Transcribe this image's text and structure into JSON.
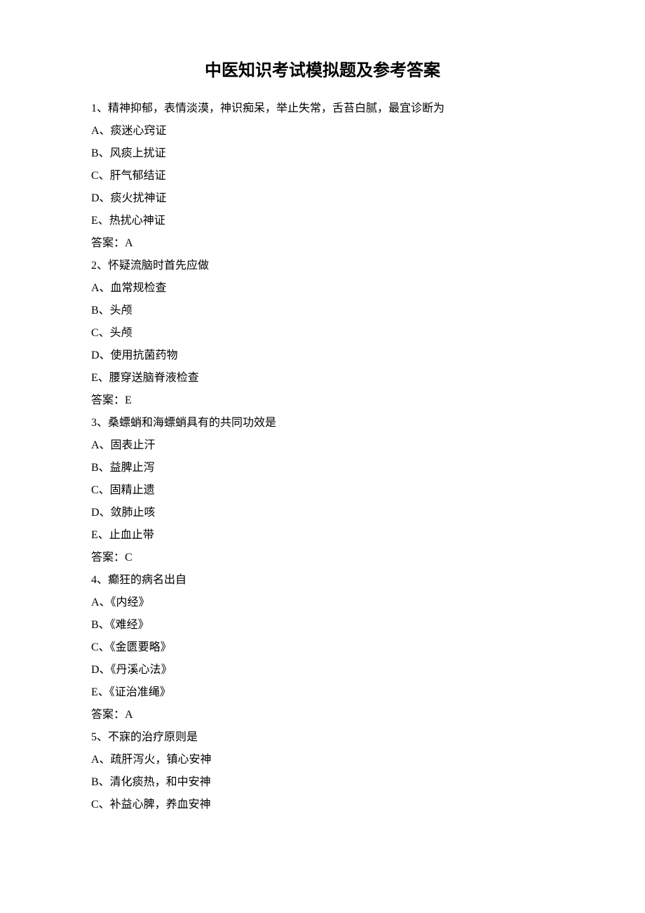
{
  "title": "中医知识考试模拟题及参考答案",
  "questions": [
    {
      "stem": "1、精神抑郁，表情淡漠，神识痴呆，举止失常，舌苔白腻，最宜诊断为",
      "options": [
        "A、痰迷心窍证",
        "B、风痰上扰证",
        "C、肝气郁结证",
        "D、痰火扰神证",
        "E、热扰心神证"
      ],
      "answer": "答案：A"
    },
    {
      "stem": "2、怀疑流脑时首先应做",
      "options": [
        "A、血常规检查",
        "B、头颅",
        "C、头颅",
        "D、使用抗菌药物",
        "E、腰穿送脑脊液检查"
      ],
      "answer": "答案：E"
    },
    {
      "stem": "3、桑螵蛸和海螵蛸具有的共同功效是",
      "options": [
        "A、固表止汗",
        "B、益脾止泻",
        "C、固精止遗",
        "D、敛肺止咳",
        "E、止血止带"
      ],
      "answer": "答案：C"
    },
    {
      "stem": "4、癫狂的病名出自",
      "options": [
        "A、《内经》",
        "B、《难经》",
        "C、《金匮要略》",
        "D、《丹溪心法》",
        "E、《证治准绳》"
      ],
      "answer": "答案：A"
    },
    {
      "stem": "5、不寐的治疗原则是",
      "options": [
        "A、疏肝泻火，镇心安神",
        "B、清化痰热，和中安神",
        "C、补益心脾，养血安神"
      ],
      "answer": ""
    }
  ]
}
